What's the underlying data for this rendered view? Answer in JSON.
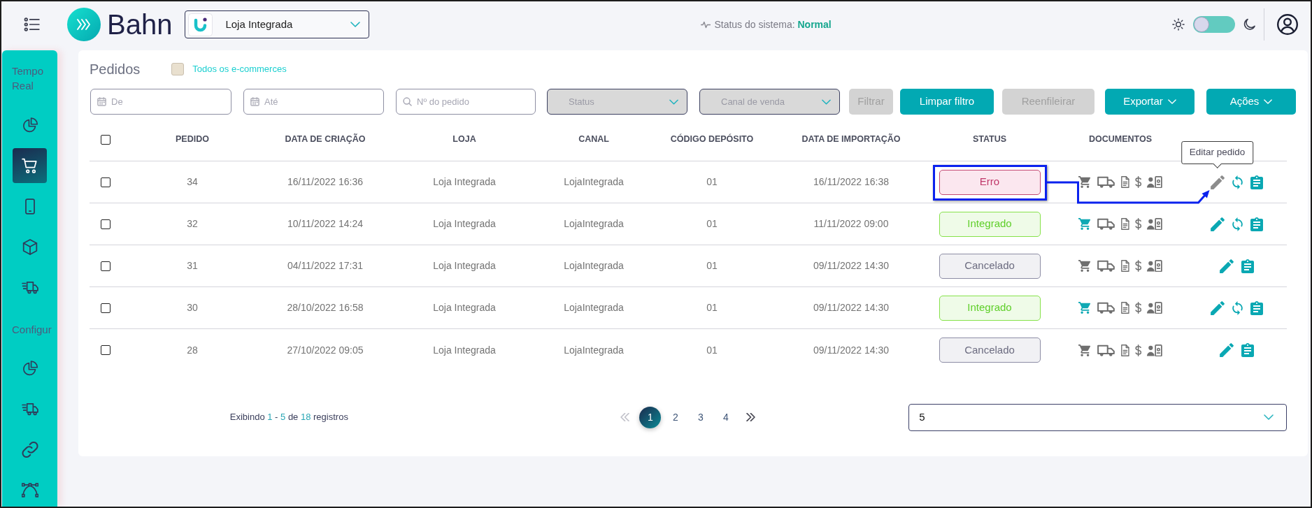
{
  "topbar": {
    "logo": {
      "text": "Bahn"
    },
    "store_select": {
      "value": "Loja Integrada"
    },
    "system_status": {
      "label": "Status do sistema:",
      "value": "Normal"
    },
    "theme_toggle": {
      "dark": false
    }
  },
  "sidebar": {
    "sections": [
      {
        "title": "Tempo Real",
        "items": [
          {
            "kind": "chart",
            "selected": false
          },
          {
            "kind": "cart",
            "selected": true
          },
          {
            "kind": "phone",
            "selected": false
          },
          {
            "kind": "box",
            "selected": false
          },
          {
            "kind": "truck",
            "selected": false
          }
        ]
      },
      {
        "title": "Configur",
        "items": [
          {
            "kind": "chart",
            "selected": false
          },
          {
            "kind": "truck",
            "selected": false
          },
          {
            "kind": "link",
            "selected": false
          },
          {
            "kind": "nodes",
            "selected": false
          }
        ]
      }
    ]
  },
  "page": {
    "title": "Pedidos",
    "all_stores": {
      "label": "Todos os e-commerces",
      "checked": false
    }
  },
  "filters": [
    {
      "kind": "date",
      "placeholder": "De"
    },
    {
      "kind": "date",
      "placeholder": "Até"
    },
    {
      "kind": "search",
      "placeholder": "Nº do pedido"
    },
    {
      "kind": "select",
      "placeholder": "Status"
    },
    {
      "kind": "select",
      "placeholder": "Canal de venda"
    },
    {
      "kind": "button",
      "label": "Filtrar",
      "disabled": true
    },
    {
      "kind": "button",
      "label": "Limpar filtro",
      "disabled": false
    },
    {
      "kind": "button",
      "label": "Reenfileirar",
      "disabled": true
    },
    {
      "kind": "menu_button",
      "label": "Exportar",
      "disabled": false
    },
    {
      "kind": "menu_button",
      "label": "Ações",
      "disabled": false
    }
  ],
  "table": {
    "select_all": {
      "checked": false
    },
    "columns": [
      "PEDIDO",
      "DATA DE CRIAÇÃO",
      "LOJA",
      "CANAL",
      "CÓDIGO DEPÓSITO",
      "DATA DE IMPORTAÇÃO",
      "STATUS",
      "DOCUMENTOS"
    ],
    "rows": [
      {
        "checked": false,
        "cells": [
          "34",
          "16/11/2022 16:36",
          "Loja Integrada",
          "LojaIntegrada",
          "01",
          "16/11/2022 16:38"
        ],
        "status": {
          "label": "Erro",
          "kind": "error",
          "annotated": true
        },
        "documents": [
          {
            "kind": "cart",
            "active": false
          },
          {
            "kind": "truck",
            "active": false
          },
          {
            "kind": "document",
            "active": false
          },
          {
            "kind": "money",
            "active": false
          },
          {
            "kind": "id_card",
            "active": false
          }
        ],
        "actions": [
          {
            "kind": "edit",
            "hovered": true,
            "tooltip": "Editar pedido"
          },
          {
            "kind": "sync",
            "hovered": false
          },
          {
            "kind": "details",
            "hovered": false
          }
        ]
      },
      {
        "checked": false,
        "cells": [
          "32",
          "10/11/2022 14:24",
          "Loja Integrada",
          "LojaIntegrada",
          "01",
          "11/11/2022 09:00"
        ],
        "status": {
          "label": "Integrado",
          "kind": "integrated",
          "annotated": false
        },
        "documents": [
          {
            "kind": "cart",
            "active": true
          },
          {
            "kind": "truck",
            "active": false
          },
          {
            "kind": "document",
            "active": false
          },
          {
            "kind": "money",
            "active": false
          },
          {
            "kind": "id_card",
            "active": false
          }
        ],
        "actions": [
          {
            "kind": "edit",
            "hovered": false
          },
          {
            "kind": "sync",
            "hovered": false
          },
          {
            "kind": "details",
            "hovered": false
          }
        ]
      },
      {
        "checked": false,
        "cells": [
          "31",
          "04/11/2022 17:31",
          "Loja Integrada",
          "LojaIntegrada",
          "01",
          "09/11/2022 14:30"
        ],
        "status": {
          "label": "Cancelado",
          "kind": "cancelled",
          "annotated": false
        },
        "documents": [
          {
            "kind": "cart",
            "active": false
          },
          {
            "kind": "truck",
            "active": false
          },
          {
            "kind": "document",
            "active": false
          },
          {
            "kind": "money",
            "active": false
          },
          {
            "kind": "id_card",
            "active": false
          }
        ],
        "actions": [
          {
            "kind": "edit",
            "hovered": false
          },
          {
            "kind": "details",
            "hovered": false
          }
        ]
      },
      {
        "checked": false,
        "cells": [
          "30",
          "28/10/2022 16:58",
          "Loja Integrada",
          "LojaIntegrada",
          "01",
          "09/11/2022 14:30"
        ],
        "status": {
          "label": "Integrado",
          "kind": "integrated",
          "annotated": false
        },
        "documents": [
          {
            "kind": "cart",
            "active": true
          },
          {
            "kind": "truck",
            "active": false
          },
          {
            "kind": "document",
            "active": false
          },
          {
            "kind": "money",
            "active": false
          },
          {
            "kind": "id_card",
            "active": false
          }
        ],
        "actions": [
          {
            "kind": "edit",
            "hovered": false
          },
          {
            "kind": "sync",
            "hovered": false
          },
          {
            "kind": "details",
            "hovered": false
          }
        ]
      },
      {
        "checked": false,
        "cells": [
          "28",
          "27/10/2022 09:05",
          "Loja Integrada",
          "LojaIntegrada",
          "01",
          "09/11/2022 14:30"
        ],
        "status": {
          "label": "Cancelado",
          "kind": "cancelled",
          "annotated": false
        },
        "documents": [
          {
            "kind": "cart",
            "active": false
          },
          {
            "kind": "truck",
            "active": false
          },
          {
            "kind": "document",
            "active": false
          },
          {
            "kind": "money",
            "active": false
          },
          {
            "kind": "id_card",
            "active": false
          }
        ],
        "actions": [
          {
            "kind": "edit",
            "hovered": false
          },
          {
            "kind": "details",
            "hovered": false
          }
        ]
      }
    ]
  },
  "pagination": {
    "summary": {
      "prefix": "Exibindo",
      "from": "1",
      "dash": "-",
      "to": "5",
      "of": "de",
      "total": "18",
      "suffix": "registros"
    },
    "first": {
      "disabled": true
    },
    "pages": [
      {
        "label": "1",
        "selected": true
      },
      {
        "label": "2",
        "selected": false
      },
      {
        "label": "3",
        "selected": false
      },
      {
        "label": "4",
        "selected": false
      }
    ],
    "last": {
      "disabled": false
    },
    "page_size": {
      "value": "5"
    }
  }
}
